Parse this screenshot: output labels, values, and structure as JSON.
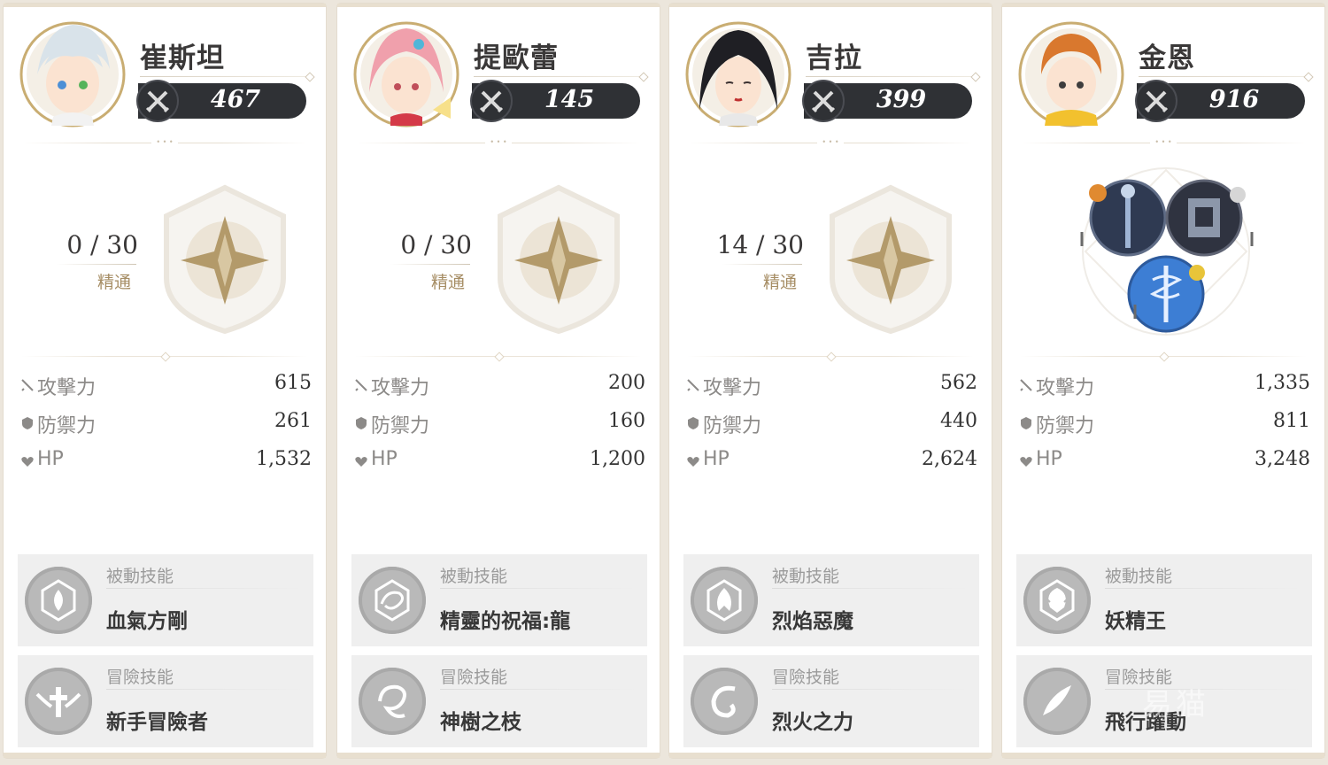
{
  "cards": [
    {
      "name": "崔斯坦",
      "power": "467",
      "mastery_value": "0 / 30",
      "mastery_label": "精通",
      "stats": [
        {
          "label": "攻擊力",
          "value": "615",
          "icon": "sword-icon"
        },
        {
          "label": "防禦力",
          "value": "261",
          "icon": "shield-icon"
        },
        {
          "label": "HP",
          "value": "1,532",
          "icon": "heart-icon"
        }
      ],
      "passive": {
        "type": "被動技能",
        "name": "血氣方剛",
        "icon": "blood-flame-icon"
      },
      "adventure": {
        "type": "冒險技能",
        "name": "新手冒險者",
        "icon": "winged-cross-icon"
      },
      "hair_color": "#d9e3ea"
    },
    {
      "name": "提歐蕾",
      "power": "145",
      "mastery_value": "0 / 30",
      "mastery_label": "精通",
      "stats": [
        {
          "label": "攻擊力",
          "value": "200",
          "icon": "sword-icon"
        },
        {
          "label": "防禦力",
          "value": "160",
          "icon": "shield-icon"
        },
        {
          "label": "HP",
          "value": "1,200",
          "icon": "heart-icon"
        }
      ],
      "passive": {
        "type": "被動技能",
        "name": "精靈的祝福:龍",
        "icon": "dragon-icon"
      },
      "adventure": {
        "type": "冒險技能",
        "name": "神樹之枝",
        "icon": "branch-icon"
      },
      "hair_color": "#f0a0ac"
    },
    {
      "name": "吉拉",
      "power": "399",
      "mastery_value": "14 / 30",
      "mastery_label": "精通",
      "stats": [
        {
          "label": "攻擊力",
          "value": "562",
          "icon": "sword-icon"
        },
        {
          "label": "防禦力",
          "value": "440",
          "icon": "shield-icon"
        },
        {
          "label": "HP",
          "value": "2,624",
          "icon": "heart-icon"
        }
      ],
      "passive": {
        "type": "被動技能",
        "name": "烈焰惡魔",
        "icon": "demon-flame-icon"
      },
      "adventure": {
        "type": "冒險技能",
        "name": "烈火之力",
        "icon": "fire-swirl-icon"
      },
      "hair_color": "#1f1f24"
    },
    {
      "name": "金恩",
      "power": "916",
      "stats": [
        {
          "label": "攻擊力",
          "value": "1,335",
          "icon": "sword-icon"
        },
        {
          "label": "防禦力",
          "value": "811",
          "icon": "shield-icon"
        },
        {
          "label": "HP",
          "value": "3,248",
          "icon": "heart-icon"
        }
      ],
      "passive": {
        "type": "被動技能",
        "name": "妖精王",
        "icon": "fairy-king-icon"
      },
      "adventure": {
        "type": "冒險技能",
        "name": "飛行躍動",
        "icon": "flight-icon"
      },
      "hair_color": "#d9782e"
    }
  ],
  "colors": {
    "power_bar": "#2f3135",
    "mastery_label": "#a68d64",
    "emblem_gold": "#b39a6a",
    "skill_panel": "#efefef"
  },
  "watermark": "易猫"
}
